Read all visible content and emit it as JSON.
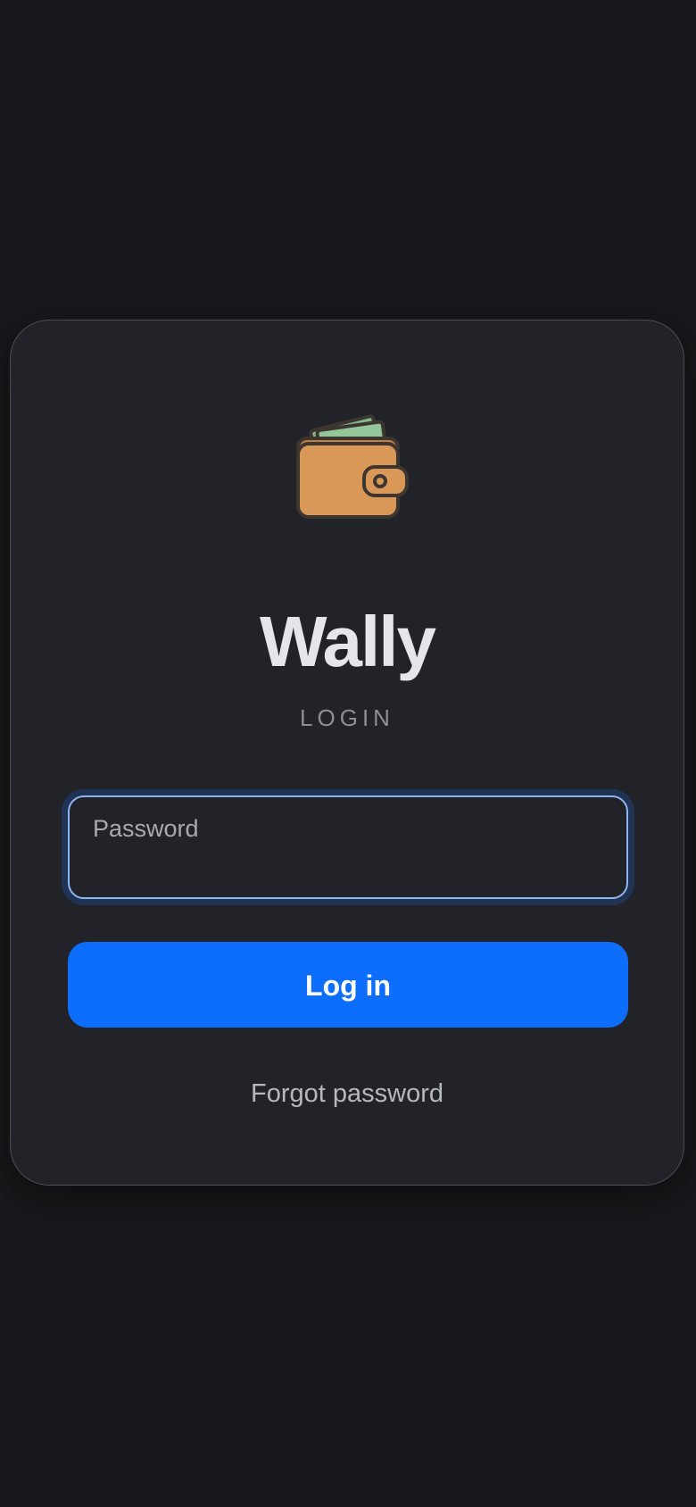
{
  "app": {
    "title": "Wally",
    "subtitle": "LOGIN",
    "logo_icon": "wallet-icon"
  },
  "form": {
    "password_label": "Password",
    "password_value": "",
    "login_button_label": "Log in",
    "forgot_password_label": "Forgot password"
  },
  "colors": {
    "background": "#17181b",
    "card": "#212328",
    "accent": "#0d6efd",
    "focus_ring": "#8fb6ee",
    "wallet": "#d99858",
    "cash": "#86b98d"
  }
}
